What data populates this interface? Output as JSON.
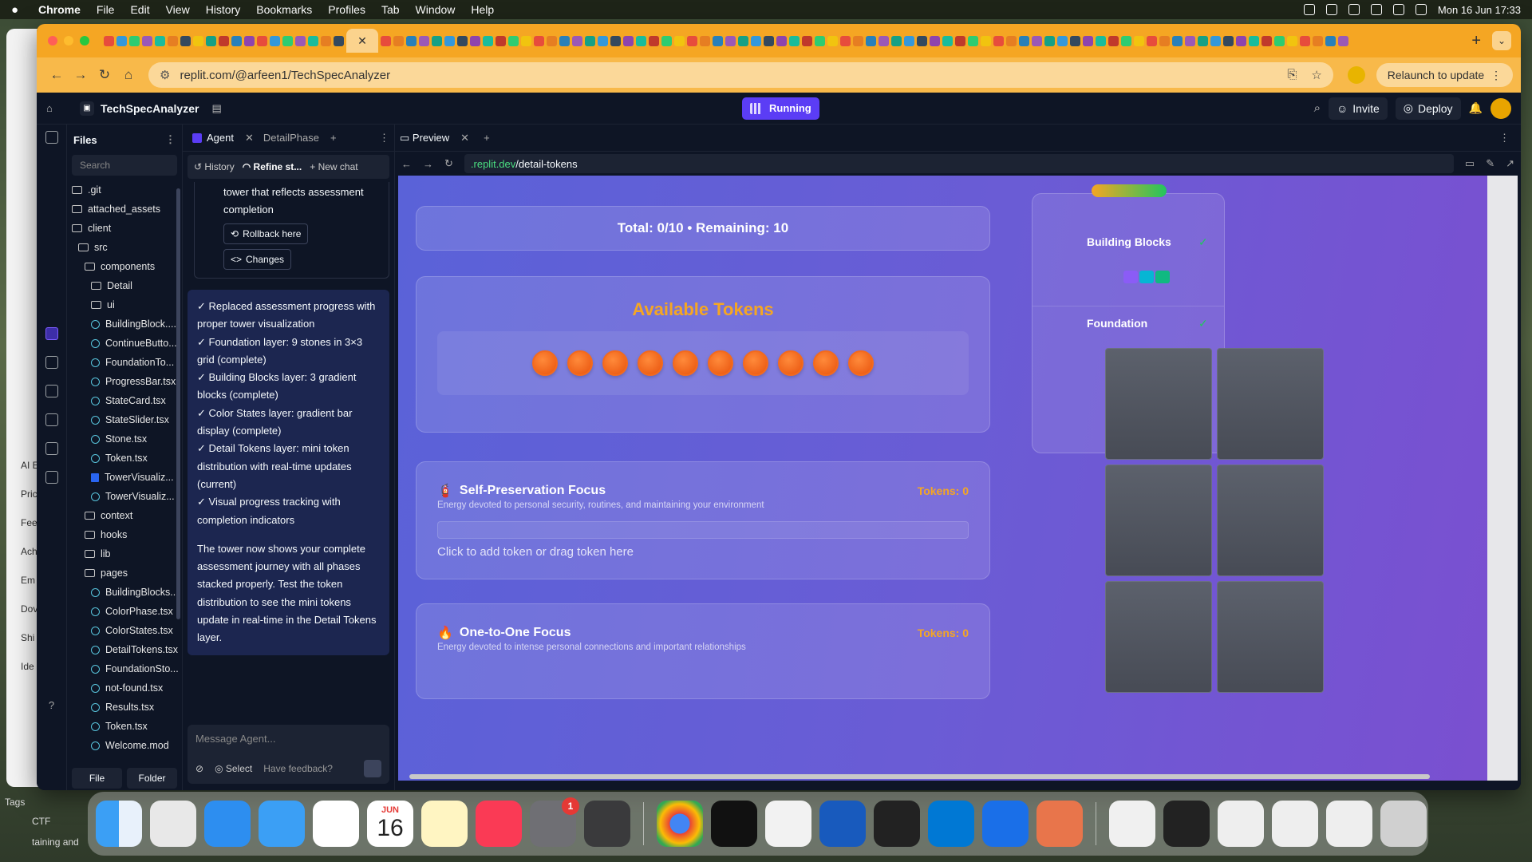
{
  "menubar": {
    "app": "Chrome",
    "items": [
      "File",
      "Edit",
      "View",
      "History",
      "Bookmarks",
      "Profiles",
      "Tab",
      "Window",
      "Help"
    ],
    "clock": "Mon 16 Jun  17:33"
  },
  "browser": {
    "url": "replit.com/@arfeen1/TechSpecAnalyzer",
    "relaunch": "Relaunch to update"
  },
  "replit": {
    "project": "TechSpecAnalyzer",
    "status": "Running",
    "invite": "Invite",
    "deploy": "Deploy"
  },
  "files": {
    "title": "Files",
    "search": "Search",
    "tree": [
      {
        "name": ".git",
        "type": "folder",
        "depth": 0
      },
      {
        "name": "attached_assets",
        "type": "folder",
        "depth": 0
      },
      {
        "name": "client",
        "type": "folder",
        "depth": 0
      },
      {
        "name": "src",
        "type": "folder",
        "depth": 1
      },
      {
        "name": "components",
        "type": "folder",
        "depth": 2
      },
      {
        "name": "Detail",
        "type": "folder",
        "depth": 3
      },
      {
        "name": "ui",
        "type": "folder",
        "depth": 3
      },
      {
        "name": "BuildingBlock....",
        "type": "tsx",
        "depth": 3
      },
      {
        "name": "ContinueButto...",
        "type": "tsx",
        "depth": 3
      },
      {
        "name": "FoundationTo...",
        "type": "tsx",
        "depth": 3
      },
      {
        "name": "ProgressBar.tsx",
        "type": "tsx",
        "depth": 3
      },
      {
        "name": "StateCard.tsx",
        "type": "tsx",
        "depth": 3
      },
      {
        "name": "StateSlider.tsx",
        "type": "tsx",
        "depth": 3
      },
      {
        "name": "Stone.tsx",
        "type": "tsx",
        "depth": 3
      },
      {
        "name": "Token.tsx",
        "type": "tsx",
        "depth": 3
      },
      {
        "name": "TowerVisualiz...",
        "type": "css",
        "depth": 3
      },
      {
        "name": "TowerVisualiz...",
        "type": "tsx",
        "depth": 3
      },
      {
        "name": "context",
        "type": "folder",
        "depth": 2
      },
      {
        "name": "hooks",
        "type": "folder",
        "depth": 2
      },
      {
        "name": "lib",
        "type": "folder",
        "depth": 2
      },
      {
        "name": "pages",
        "type": "folder",
        "depth": 2
      },
      {
        "name": "BuildingBlocks...",
        "type": "tsx",
        "depth": 3
      },
      {
        "name": "ColorPhase.tsx",
        "type": "tsx",
        "depth": 3
      },
      {
        "name": "ColorStates.tsx",
        "type": "tsx",
        "depth": 3
      },
      {
        "name": "DetailTokens.tsx",
        "type": "tsx",
        "depth": 3
      },
      {
        "name": "FoundationSto...",
        "type": "tsx",
        "depth": 3
      },
      {
        "name": "not-found.tsx",
        "type": "tsx",
        "depth": 3
      },
      {
        "name": "Results.tsx",
        "type": "tsx",
        "depth": 3
      },
      {
        "name": "Token.tsx",
        "type": "tsx",
        "depth": 3
      },
      {
        "name": "Welcome.mod",
        "type": "tsx",
        "depth": 3
      }
    ],
    "new_file": "File",
    "new_folder": "Folder"
  },
  "agent": {
    "tab1": "Agent",
    "tab2": "DetailPhase",
    "history": "History",
    "refine": "Refine st...",
    "new_chat": "New chat",
    "prev_tail": "tower that reflects assessment completion",
    "rollback": "Rollback here",
    "changes": "Changes",
    "checks": [
      "✓ Replaced assessment progress with proper tower visualization",
      "✓ Foundation layer: 9 stones in 3×3 grid (complete)",
      "✓ Building Blocks layer: 3 gradient blocks (complete)",
      "✓ Color States layer: gradient bar display (complete)",
      "✓ Detail Tokens layer: mini token distribution with real-time updates (current)",
      "✓ Visual progress tracking with completion indicators"
    ],
    "summary": "The tower now shows your complete assessment journey with all phases stacked properly. Test the token distribution to see the mini tokens update in real-time in the Detail Tokens layer.",
    "placeholder": "Message Agent...",
    "select": "Select",
    "feedback": "Have feedback?"
  },
  "preview": {
    "tab": "Preview",
    "url_domain": ".replit.dev",
    "url_path": "/detail-tokens",
    "totals": "Total: 0/10 • Remaining: 10",
    "available_title": "Available Tokens",
    "token_count": 10,
    "focus1": {
      "icon": "🧯",
      "title": "Self-Preservation Focus",
      "tokens": "Tokens: 0",
      "desc": "Energy devoted to personal security, routines, and maintaining your environment",
      "drop": "Click to add token or drag token here"
    },
    "focus2": {
      "icon": "🔥",
      "title": "One-to-One Focus",
      "tokens": "Tokens: 0",
      "desc": "Energy devoted to intense personal connections and important relationships"
    },
    "tower": {
      "building_blocks": "Building Blocks",
      "foundation": "Foundation",
      "check": "✓"
    }
  },
  "left_peek": [
    "AI E",
    "Pric",
    "Fee",
    "Ach",
    "Em",
    "Dov",
    "Shi",
    "Ide"
  ],
  "below_left": [
    "Tags",
    "CTF",
    "taining and"
  ],
  "dock_calendar": {
    "month": "JUN",
    "day": "16"
  },
  "dock_badge": "1",
  "colors": {
    "accent": "#5b3df5",
    "token": "#f46a1c",
    "tokens_label": "#f5a623",
    "chrome_tab": "#f5a623"
  }
}
